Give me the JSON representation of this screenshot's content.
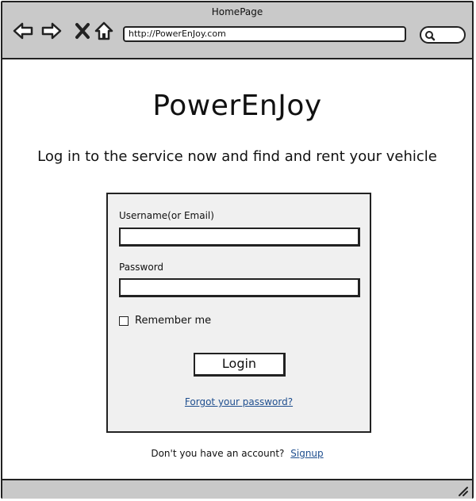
{
  "window": {
    "title": "HomePage"
  },
  "browser": {
    "url": "http://PowerEnJoy.com",
    "icons": [
      "back-arrow-icon",
      "forward-arrow-icon",
      "close-x-icon",
      "home-icon",
      "search-icon",
      "resize-grip-icon"
    ]
  },
  "page": {
    "brand": "PowerEnJoy",
    "tagline": "Log in to the service now and find and rent your vehicle"
  },
  "login_form": {
    "username_label": "Username(or Email)",
    "username_value": "",
    "password_label": "Password",
    "password_value": "",
    "remember_label": "Remember me",
    "remember_checked": false,
    "login_button": "Login",
    "forgot_link": "Forgot your password?"
  },
  "signup": {
    "prompt": "Don't you have an account?",
    "link": "Signup"
  },
  "colors": {
    "chrome": "#c9c9c9",
    "panel": "#f0f0f0",
    "link": "#1f4f8f"
  }
}
